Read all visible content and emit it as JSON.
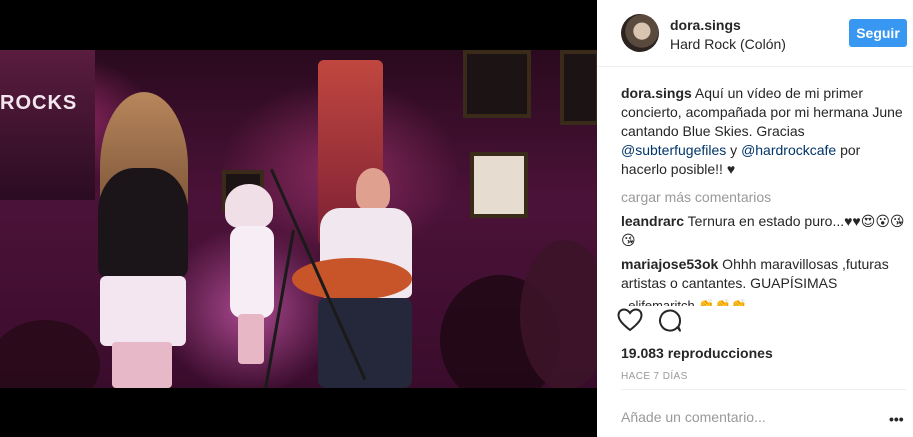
{
  "post": {
    "username": "dora.sings",
    "location": "Hard Rock (Colón)",
    "follow_label": "Seguir",
    "caption": {
      "username": "dora.sings",
      "text_1": " Aquí un vídeo de mi primer concierto, acompañada por mi hermana June cantando Blue Skies. Gracias ",
      "mention_1": "@subterfugefiles",
      "text_2": " y ",
      "mention_2": "@hardrockcafe",
      "text_3": " por hacerlo posible!! ♥"
    },
    "load_more_label": "cargar más comentarios",
    "comments": [
      {
        "user": "leandrarc",
        "text": " Ternura en estado puro...♥♥😍😮😘😘"
      },
      {
        "user": "mariajose53ok",
        "text": " Ohhh maravillosas ,futuras artistas o cantantes. GUAPÍSIMAS"
      }
    ],
    "partial_comment": "_elifemaritch 👏👏👏",
    "views": "19.083 reproducciones",
    "timestamp": "HACE 7 DÍAS",
    "add_comment_placeholder": "Añade un comentario...",
    "more_label": "•••"
  },
  "video": {
    "banner_text": "ROCKS"
  },
  "colors": {
    "accent": "#3897f0",
    "mention": "#003569",
    "muted": "#999999"
  },
  "icons": [
    "heart-icon",
    "comment-icon",
    "more-icon"
  ]
}
